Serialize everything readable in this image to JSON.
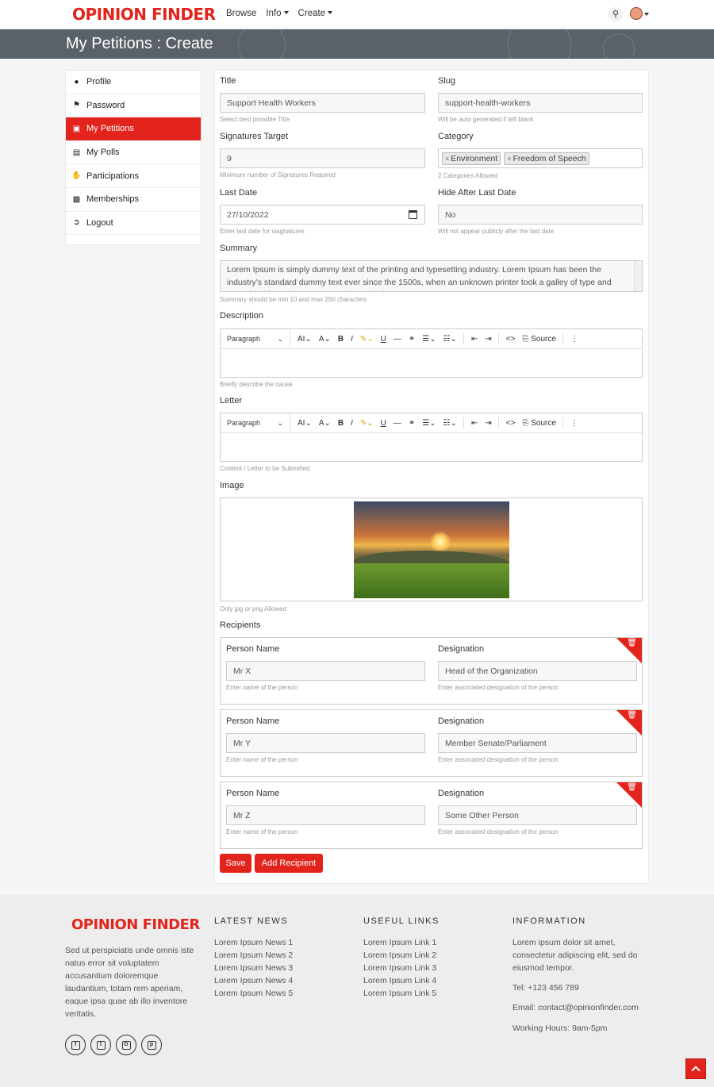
{
  "nav": {
    "logo": "OPINION FINDER",
    "links": [
      "Browse",
      "Info",
      "Create"
    ]
  },
  "banner": {
    "title": "My Petitions : Create"
  },
  "sidebar": {
    "items": [
      {
        "label": "Profile",
        "icon": "user-icon"
      },
      {
        "label": "Password",
        "icon": "key-icon"
      },
      {
        "label": "My Petitions",
        "icon": "clipboard-icon",
        "active": true
      },
      {
        "label": "My Polls",
        "icon": "chart-icon"
      },
      {
        "label": "Participations",
        "icon": "hand-icon"
      },
      {
        "label": "Memberships",
        "icon": "id-card-icon"
      },
      {
        "label": "Logout",
        "icon": "logout-icon"
      }
    ]
  },
  "form": {
    "title": {
      "label": "Title",
      "value": "Support Health Workers",
      "help": "Select best possible Title"
    },
    "slug": {
      "label": "Slug",
      "value": "support-health-workers",
      "help": "Will be auto generated if left blank"
    },
    "signatures": {
      "label": "Signatures Target",
      "value": "9",
      "help": "Minimum number of Signatures Required"
    },
    "category": {
      "label": "Category",
      "tags": [
        "Environment",
        "Freedom of Speech"
      ],
      "help": "2 Categories Allowed"
    },
    "last_date": {
      "label": "Last Date",
      "value": "27/10/2022",
      "help": "Enter last date for siagnatures"
    },
    "hide_after": {
      "label": "Hide After Last Date",
      "value": "No",
      "help": "Will not appear publicly after the last date"
    },
    "summary": {
      "label": "Summary",
      "value": "Lorem Ipsum is simply dummy text of the printing and typesetting industry. Lorem Ipsum has been the industry's standard dummy text ever since the 1500s, when an unknown printer took a galley of type and scrambled it to make a type specimen book.",
      "help": "Summary should be min 10 and max 250 characters"
    },
    "description": {
      "label": "Description",
      "help": "Briefly describe the cause"
    },
    "letter": {
      "label": "Letter",
      "help": "Content / Letter to be Submitted"
    },
    "image": {
      "label": "Image",
      "help": "Only jpg or png Allowed"
    },
    "recipients_label": "Recipients",
    "recipients": [
      {
        "name_label": "Person Name",
        "name": "Mr X",
        "name_help": "Enter name of the person",
        "des_label": "Designation",
        "designation": "Head of the Organization",
        "des_help": "Enter associated designation of the person"
      },
      {
        "name_label": "Person Name",
        "name": "Mr Y",
        "name_help": "Enter name of the person",
        "des_label": "Designation",
        "designation": "Member Senate/Parliament",
        "des_help": "Enter associated designation of the person"
      },
      {
        "name_label": "Person Name",
        "name": "Mr Z",
        "name_help": "Enter name of the person",
        "des_label": "Designation",
        "designation": "Some Other Person",
        "des_help": "Enter associated designation of the person"
      }
    ],
    "save_label": "Save",
    "add_recipient_label": "Add Recipient"
  },
  "editor": {
    "paragraph": "Paragraph",
    "source": "Source"
  },
  "footer": {
    "logo": "OPINION FINDER",
    "desc": "Sed ut perspiciatis unde omnis iste natus error sit voluptatem accusantium doloremque laudantium, totam rem aperiam, eaque ipsa quae ab illo inventore veritatis.",
    "news_title": "LATEST NEWS",
    "news": [
      "Lorem Ipsum News 1",
      "Lorem Ipsum News 2",
      "Lorem Ipsum News 3",
      "Lorem Ipsum News 4",
      "Lorem Ipsum News 5"
    ],
    "links_title": "USEFUL LINKS",
    "links": [
      "Lorem Ipsum Link 1",
      "Lorem Ipsum Link 2",
      "Lorem Ipsum Link 3",
      "Lorem Ipsum Link 4",
      "Lorem Ipsum Link 5"
    ],
    "info_title": "INFORMATION",
    "info_text": "Lorem ipsum dolor sit amet, consectetur adipiscing elit, sed do eiusmod tempor.",
    "tel": "Tel: +123 456 789",
    "email": "Email: contact@opinionfinder.com",
    "hours": "Working Hours: 9am-5pm",
    "social": [
      "facebook-icon",
      "twitter-icon",
      "google-plus-icon",
      "pinterest-icon"
    ]
  },
  "colors": {
    "accent": "#e3241c",
    "banner": "#5a6169",
    "footer": "#ededed"
  }
}
